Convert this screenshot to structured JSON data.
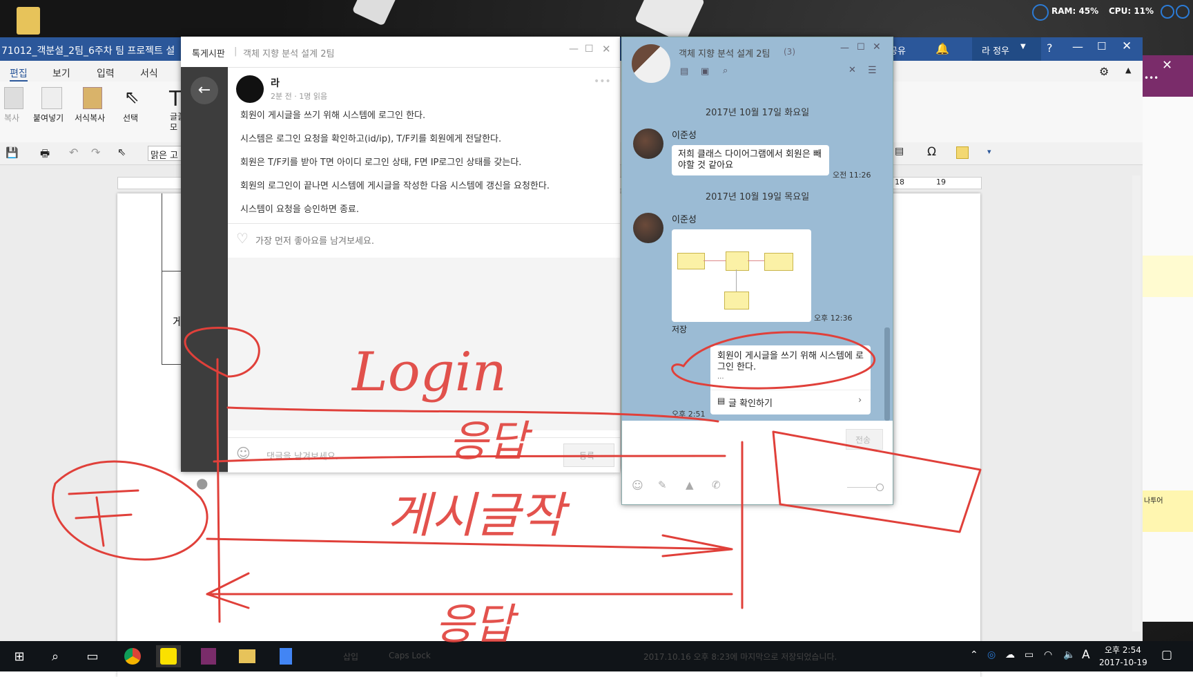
{
  "system_monitor": {
    "ram": "RAM: 45%",
    "cpu": "CPU: 11%"
  },
  "word": {
    "title": "71012_객분설_2팀_6주차 팀 프로젝트 설",
    "share_label": "공유",
    "user_label": "라 정우",
    "tabs": [
      "편집",
      "보기",
      "입력",
      "서식"
    ],
    "ribbon": {
      "copy": "복사",
      "paste": "붙여넣기",
      "format_copy": "서식복사",
      "select": "선택",
      "font_abbr": "글꼴\n모"
    },
    "font_name": "맑은 고",
    "doc_text_fragment": "게",
    "ruler_marks": [
      "18",
      "19"
    ]
  },
  "board": {
    "title": "톡게시판",
    "subtitle": "객체 지향 분석 설계 2팀",
    "author": "라",
    "meta": "2분 전 · 1명 읽음",
    "lines": [
      "회원이 게시글을 쓰기 위해 시스템에 로그인 한다.",
      "시스템은 로그인 요청을 확인하고(id/ip), T/F키를 회원에게 전달한다.",
      "회원은 T/F키를 받아 T면 아이디 로그인 상태, F면 IP로그인 상태를 갖는다.",
      "회원의 로그인이 끝나면 시스템에 게시글을 작성한 다음 시스템에 갱신을 요청한다.",
      "시스템이 요청을 승인하면 종료."
    ],
    "like_prompt": "가장 먼저 좋아요를 남겨보세요.",
    "comment_placeholder": "댓글을 남겨보세요.",
    "submit_label": "등록"
  },
  "chat": {
    "title": "객체 지향 분석 설계 2팀",
    "member_count": "(3)",
    "date1": "2017년 10월 17일 화요일",
    "msg1_sender": "이준성",
    "msg1_text": "저희 클래스 다이어그램에서 회원은 빼야할 것 같아요",
    "msg1_time": "오전 11:26",
    "date2": "2017년 10월 19일 목요일",
    "msg2_sender": "이준성",
    "msg2_time": "오후 12:36",
    "save_label": "저장",
    "msg3_text": "회원이 게시글을 쓰기 위해 시스템에 로그인 한다.",
    "msg3_ellipsis": "...",
    "msg3_link": "글 확인하기",
    "msg3_time": "오후 2:51",
    "send_label": "전송"
  },
  "onenote": {
    "note_text": "나투어"
  },
  "taskbar": {
    "time": "오후 2:54",
    "date": "2017-10-19",
    "ime": "A",
    "faded_status": "2017.10.16 오후 8:23에 마지막으로 저장되었습니다.",
    "faded_caps": "Caps Lock",
    "faded_insert": "삽입"
  },
  "ink_annotations": [
    "Login",
    "응답",
    "게시글작",
    "응답"
  ]
}
